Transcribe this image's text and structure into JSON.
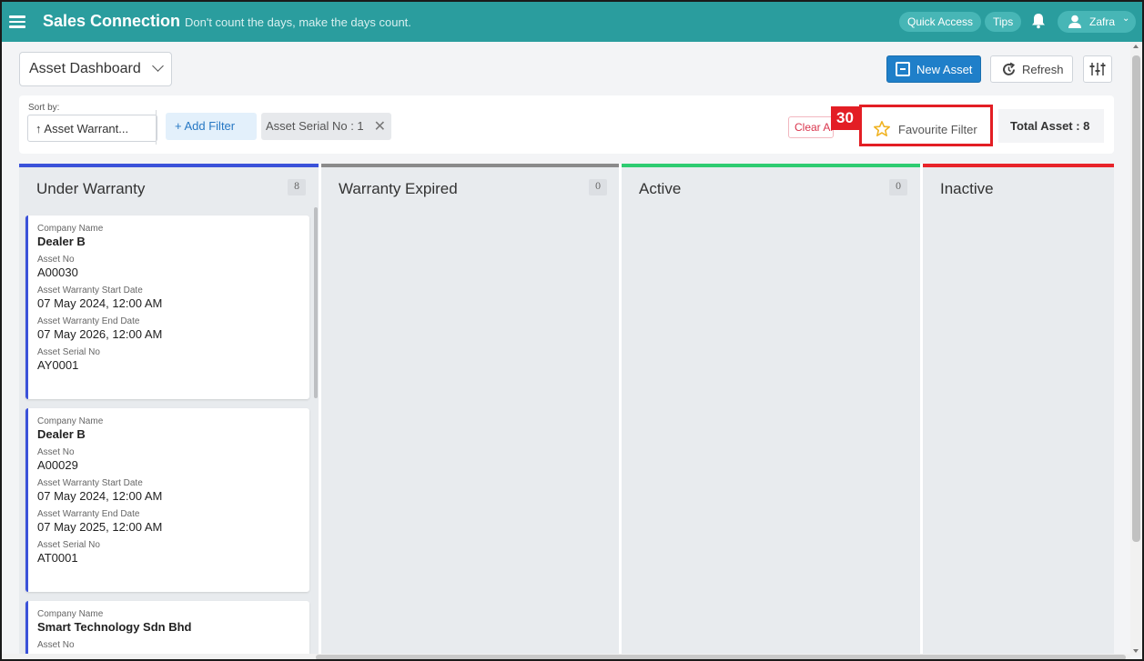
{
  "topbar": {
    "brand": "Sales Connection",
    "tagline": "Don't count the days, make the days count.",
    "quick_access": "Quick Access",
    "tips": "Tips",
    "user": "Zafra"
  },
  "header": {
    "dashboard": "Asset Dashboard",
    "new_asset": "New Asset",
    "refresh": "Refresh"
  },
  "filters": {
    "sort_label": "Sort by:",
    "sort_value": "↑ Asset Warrant...",
    "add_filter": "+ Add Filter",
    "chip": "Asset Serial No : 1",
    "clear_all": "Clear All",
    "favourite": "Favourite Filter",
    "total": "Total Asset : 8"
  },
  "annotation": {
    "step": "30"
  },
  "columns": [
    {
      "title": "Under Warranty",
      "count": "8",
      "color": "#3b52d9"
    },
    {
      "title": "Warranty Expired",
      "count": "0",
      "color": "#8a8a8a"
    },
    {
      "title": "Active",
      "count": "0",
      "color": "#2ecc71"
    },
    {
      "title": "Inactive",
      "count": "",
      "color": "#e8242a"
    }
  ],
  "cards": [
    {
      "company_label": "Company Name",
      "company": "Dealer B",
      "asset_no_label": "Asset No",
      "asset_no": "A00030",
      "start_label": "Asset Warranty Start Date",
      "start": "07 May 2024, 12:00 AM",
      "end_label": "Asset Warranty End Date",
      "end": "07 May 2026, 12:00 AM",
      "serial_label": "Asset Serial No",
      "serial": "AY0001"
    },
    {
      "company_label": "Company Name",
      "company": "Dealer B",
      "asset_no_label": "Asset No",
      "asset_no": "A00029",
      "start_label": "Asset Warranty Start Date",
      "start": "07 May 2024, 12:00 AM",
      "end_label": "Asset Warranty End Date",
      "end": "07 May 2025, 12:00 AM",
      "serial_label": "Asset Serial No",
      "serial": "AT0001"
    },
    {
      "company_label": "Company Name",
      "company": "Smart Technology Sdn Bhd",
      "asset_no_label": "Asset No"
    }
  ]
}
